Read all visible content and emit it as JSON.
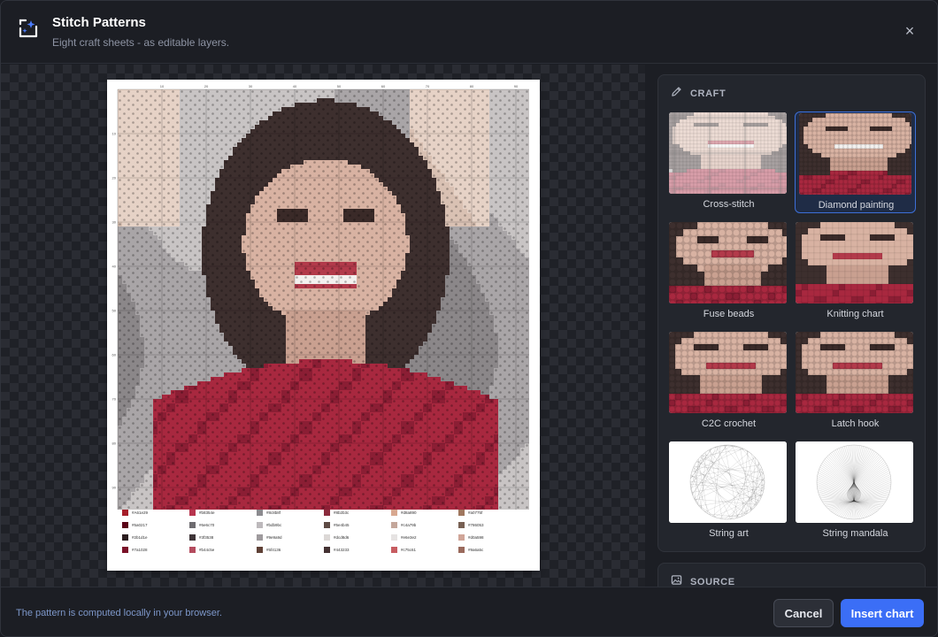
{
  "header": {
    "title": "Stitch Patterns",
    "subtitle": "Eight craft sheets - as editable layers.",
    "close_symbol": "×",
    "icons": {
      "app": "frame-sparkle-icon",
      "close": "close-icon"
    }
  },
  "preview": {
    "top_ruler": [
      "10",
      "20",
      "30",
      "40",
      "50",
      "60",
      "70",
      "80",
      "90"
    ],
    "left_ruler": [
      "10",
      "20",
      "30",
      "40",
      "50",
      "60",
      "70",
      "80",
      "90"
    ],
    "legend": [
      {
        "code": "#A61e29",
        "color": "#a61e29"
      },
      {
        "code": "#b8354e",
        "color": "#b8354e"
      },
      {
        "code": "#8c8b8f",
        "color": "#8c8b8f"
      },
      {
        "code": "#8b2b3c",
        "color": "#8b2b3c"
      },
      {
        "code": "#d8a890",
        "color": "#d8a890"
      },
      {
        "code": "#a0775f",
        "color": "#a0775f"
      },
      {
        "code": "#5a0217",
        "color": "#5a0217"
      },
      {
        "code": "#6e6c70",
        "color": "#6e6c70"
      },
      {
        "code": "#bdb9bc",
        "color": "#bdb9bc"
      },
      {
        "code": "#5e4b45",
        "color": "#5e4b45"
      },
      {
        "code": "#c4a79b",
        "color": "#c4a79b"
      },
      {
        "code": "#786053",
        "color": "#786053"
      },
      {
        "code": "#2b1d1e",
        "color": "#2b1d1e"
      },
      {
        "code": "#3f3538",
        "color": "#3f3538"
      },
      {
        "code": "#9e9a9d",
        "color": "#9e9a9d"
      },
      {
        "code": "#dcd8d6",
        "color": "#dcd8d6"
      },
      {
        "code": "#e6e3e2",
        "color": "#e6e3e2"
      },
      {
        "code": "#d0a598",
        "color": "#d0a598"
      },
      {
        "code": "#7a1028",
        "color": "#7a1028"
      },
      {
        "code": "#b44c5e",
        "color": "#b44c5e"
      },
      {
        "code": "#5f4136",
        "color": "#5f4136"
      },
      {
        "code": "#443233",
        "color": "#443233"
      },
      {
        "code": "#c75c61",
        "color": "#c75c61"
      },
      {
        "code": "#9a6a5c",
        "color": "#9a6a5c"
      }
    ]
  },
  "panel": {
    "craft_label": "CRAFT",
    "source_label": "SOURCE",
    "icons": {
      "craft": "pencil-icon",
      "source": "image-icon"
    },
    "crafts": [
      {
        "label": "Cross-stitch",
        "selected": false
      },
      {
        "label": "Diamond painting",
        "selected": true
      },
      {
        "label": "Fuse beads",
        "selected": false
      },
      {
        "label": "Knitting chart",
        "selected": false
      },
      {
        "label": "C2C crochet",
        "selected": false
      },
      {
        "label": "Latch hook",
        "selected": false
      },
      {
        "label": "String art",
        "selected": false
      },
      {
        "label": "String mandala",
        "selected": false
      }
    ]
  },
  "footer": {
    "note": "The pattern is computed locally in your browser.",
    "cancel_label": "Cancel",
    "insert_label": "Insert chart"
  },
  "colors": {
    "accent": "#3b6ef6",
    "selected_border": "#3d6fd8",
    "background": "#1c1e24",
    "panel": "#23262d"
  }
}
